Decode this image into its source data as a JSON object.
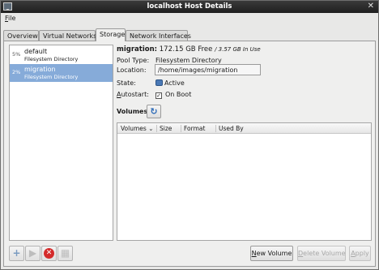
{
  "window": {
    "title": "localhost Host Details"
  },
  "menu": {
    "file_mnemonic": "F",
    "file_rest": "ile"
  },
  "tabs": [
    {
      "label": "Overview",
      "active": false
    },
    {
      "label": "Virtual Networks",
      "active": false
    },
    {
      "label": "Storage",
      "active": true
    },
    {
      "label": "Network Interfaces",
      "active": false
    }
  ],
  "pools": [
    {
      "percent": "5%",
      "name": "default",
      "type": "Filesystem Directory",
      "selected": false
    },
    {
      "percent": "2%",
      "name": "migration",
      "type": "Filesystem Directory",
      "selected": true
    }
  ],
  "details": {
    "name": "migration:",
    "free": "172.15 GB Free",
    "in_use": "/ 3.57 GB In Use",
    "pool_type_label": "Pool Type:",
    "pool_type_value": "Filesystem Directory",
    "location_label": "Location:",
    "location_value": "/home/images/migration",
    "state_label": "State:",
    "state_value": "Active",
    "autostart_mnemonic": "A",
    "autostart_rest": "utostart:",
    "autostart_value": "On Boot",
    "autostart_checked": true,
    "volumes_label": "Volumes"
  },
  "volume_columns": [
    "Volumes",
    "Size",
    "Format",
    "Used By"
  ],
  "buttons": {
    "new_volume_mnemonic": "N",
    "new_volume_rest": "ew Volume",
    "delete_volume_mnemonic": "D",
    "delete_volume_rest": "elete Volume",
    "apply_mnemonic": "A",
    "apply_rest": "pply"
  },
  "icons": {
    "add": "add-pool-icon",
    "start": "start-pool-icon",
    "stop": "stop-pool-icon",
    "delete": "delete-pool-icon",
    "refresh": "refresh-icon"
  },
  "colors": {
    "selection": "#86abd9",
    "titlebar": "#2a2a2a",
    "delete_red": "#d42b2b"
  }
}
